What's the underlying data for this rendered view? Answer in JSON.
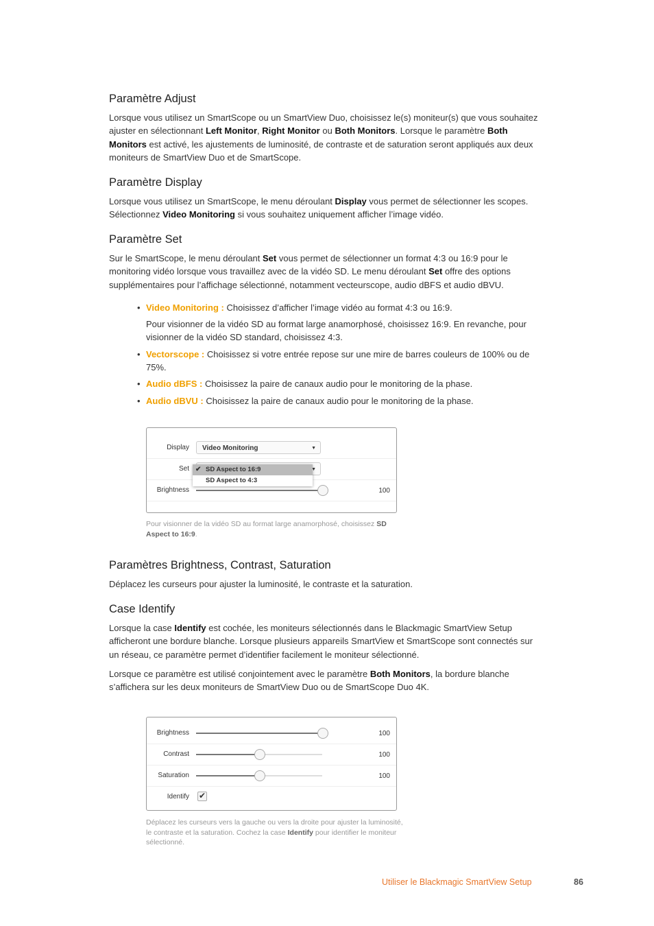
{
  "sections": [
    {
      "title": "Paramètre Adjust",
      "paras": [
        [
          {
            "t": "Lorsque vous utilisez un SmartScope ou un SmartView Duo, choisissez le(s) moniteur(s) que vous souhaitez ajuster en sélectionnant "
          },
          {
            "t": "Left Monitor",
            "b": 1
          },
          {
            "t": ", "
          },
          {
            "t": "Right Monitor",
            "b": 1
          },
          {
            "t": " ou "
          },
          {
            "t": "Both Monitors",
            "b": 1
          },
          {
            "t": ". Lorsque le paramètre "
          },
          {
            "t": "Both Monitors",
            "b": 1
          },
          {
            "t": " est activé, les ajustements de luminosité, de contraste et de saturation seront appliqués aux deux moniteurs de SmartView Duo et de SmartScope."
          }
        ]
      ]
    },
    {
      "title": "Paramètre Display",
      "paras": [
        [
          {
            "t": "Lorsque vous utilisez un SmartScope, le menu déroulant "
          },
          {
            "t": "Display",
            "b": 1
          },
          {
            "t": " vous permet de sélectionner les scopes. Sélectionnez "
          },
          {
            "t": "Video Monitoring",
            "b": 1
          },
          {
            "t": " si vous souhaitez uniquement afficher l’image vidéo."
          }
        ]
      ]
    },
    {
      "title": "Paramètre Set",
      "paras": [
        [
          {
            "t": "Sur le SmartScope, le menu déroulant "
          },
          {
            "t": "Set",
            "b": 1
          },
          {
            "t": " vous permet de sélectionner un format 4:3 ou 16:9 pour le monitoring vidéo lorsque vous travaillez avec de la vidéo SD. Le menu déroulant "
          },
          {
            "t": "Set",
            "b": 1
          },
          {
            "t": " offre des options supplémentaires pour l’affichage sélectionné, notamment vecteurscope, audio dBFS et audio dBVU."
          }
        ]
      ]
    },
    {
      "title": "Paramètres Brightness, Contrast, Saturation",
      "paras": [
        [
          {
            "t": "Déplacez les curseurs pour ajuster la luminosité, le contraste et la saturation."
          }
        ]
      ]
    },
    {
      "title": "Case Identify",
      "paras": [
        [
          {
            "t": "Lorsque la case "
          },
          {
            "t": "Identify",
            "b": 1
          },
          {
            "t": " est cochée, les moniteurs sélectionnés dans le Blackmagic SmartView Setup afficheront une bordure blanche. Lorsque plusieurs appareils SmartView et SmartScope sont connectés sur un réseau, ce paramètre permet d’identifier facilement le moniteur sélectionné."
          }
        ],
        [
          {
            "t": "Lorsque ce paramètre est utilisé conjointement avec le paramètre "
          },
          {
            "t": "Both Monitors",
            "b": 1
          },
          {
            "t": ", la bordure blanche s’affichera sur les deux moniteurs de SmartView Duo ou de SmartScope Duo 4K."
          }
        ]
      ]
    }
  ],
  "bullets": [
    {
      "term": "Video Monitoring :",
      "text": " Choisissez d’afficher l’image vidéo au format 4:3 ou 16:9.",
      "sub": "Pour visionner de la vidéo SD au format large anamorphosé, choisissez 16:9. En revanche, pour visionner de la vidéo SD standard, choisissez 4:3."
    },
    {
      "term": "Vectorscope :",
      "text": " Choisissez si votre entrée repose sur une mire de barres couleurs de 100% ou de 75%."
    },
    {
      "term": "Audio dBFS :",
      "text": " Choisissez la paire de canaux audio pour le monitoring de la phase."
    },
    {
      "term": "Audio dBVU :",
      "text": " Choisissez la paire de canaux audio pour le monitoring de la phase."
    }
  ],
  "fig1": {
    "display_label": "Display",
    "display_value": "Video Monitoring",
    "set_label": "Set",
    "set_options": [
      "SD Aspect to 16:9",
      "SD Aspect to 4:3"
    ],
    "set_selected": "SD Aspect to 16:9",
    "brightness_label": "Brightness",
    "brightness_value": "100",
    "brightness_level": 1.0,
    "caption": [
      {
        "t": "Pour visionner de la vidéo SD au format large anamorphosé, choisissez "
      },
      {
        "t": "SD Aspect to 16:9",
        "b": 1
      },
      {
        "t": "."
      }
    ]
  },
  "fig2": {
    "sliders": [
      {
        "label": "Brightness",
        "value": "100",
        "level": 1.0
      },
      {
        "label": "Contrast",
        "value": "100",
        "level": 0.5
      },
      {
        "label": "Saturation",
        "value": "100",
        "level": 0.5
      }
    ],
    "identify_label": "Identify",
    "identify_checked": true,
    "caption": [
      {
        "t": "Déplacez les curseurs vers la gauche ou vers la droite pour ajuster la luminosité, le contraste et la saturation. Cochez la case "
      },
      {
        "t": "Identify",
        "b": 1
      },
      {
        "t": " pour identifier le moniteur sélectionné."
      }
    ]
  },
  "footer": {
    "title": "Utiliser le Blackmagic SmartView Setup",
    "page": "86",
    "accent": "#e8762b"
  },
  "colors": {
    "bullet_term": "#f0a000"
  }
}
